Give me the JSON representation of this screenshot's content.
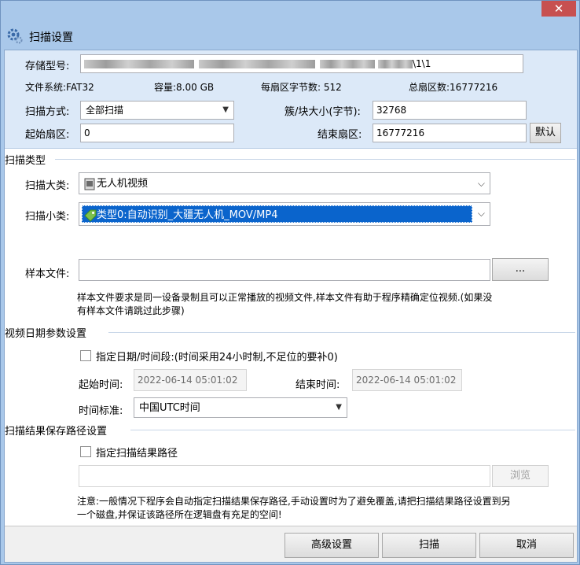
{
  "window": {
    "close": "✕"
  },
  "header": {
    "title": "扫描设置",
    "icon": "gear-icon"
  },
  "storage": {
    "model_label": "存储型号:",
    "model_suffix": "\\1\\1",
    "fs_label": "文件系统:",
    "fs_value": "FAT32",
    "capacity_label": "容量:",
    "capacity_value": "8.00 GB",
    "bps_label": "每扇区字节数:",
    "bps_value": "512",
    "total_label": "总扇区数:",
    "total_value": "16777216",
    "scan_mode_label": "扫描方式:",
    "scan_mode_value": "全部扫描",
    "cluster_label": "簇/块大小(字节):",
    "cluster_value": "32768",
    "start_label": "起始扇区:",
    "start_value": "0",
    "end_label": "结束扇区:",
    "end_value": "16777216",
    "default_button": "默认"
  },
  "scan_type": {
    "title": "扫描类型",
    "category_label": "扫描大类:",
    "category_value": "无人机视频",
    "subcategory_label": "扫描小类:",
    "subcategory_value": "类型0:自动识别_大疆无人机_MOV/MP4",
    "sample_label": "样本文件:",
    "sample_value": "",
    "browse_dots": "...",
    "note": "样本文件要求是同一设备录制且可以正常播放的视频文件,样本文件有助于程序精确定位视频.(如果没有样本文件请跳过此步骤)"
  },
  "video_date": {
    "title": "视频日期参数设置",
    "checkbox_label": "指定日期/时间段:(时间采用24小时制,不足位的要补0)",
    "start_label": "起始时间:",
    "start_value": "2022-06-14 05:01:02",
    "end_label": "结束时间:",
    "end_value": "2022-06-14 05:01:02",
    "tz_label": "时间标准:",
    "tz_value": "中国UTC时间"
  },
  "result_path": {
    "title": "扫描结果保存路径设置",
    "checkbox_label": "指定扫描结果路径",
    "path_value": "",
    "browse_button": "浏览",
    "note": "注意:一般情况下程序会自动指定扫描结果保存路径,手动设置时为了避免覆盖,请把扫描结果路径设置到另一个磁盘,并保证该路径所在逻辑盘有充足的空间!"
  },
  "footer": {
    "advanced_button": "高级设置",
    "scan_button": "扫描",
    "cancel_button": "取消"
  },
  "colors": {
    "window_frame": "#a9c8ea",
    "panel": "#dce9f8",
    "selection": "#0a64cc",
    "close": "#c75050"
  }
}
